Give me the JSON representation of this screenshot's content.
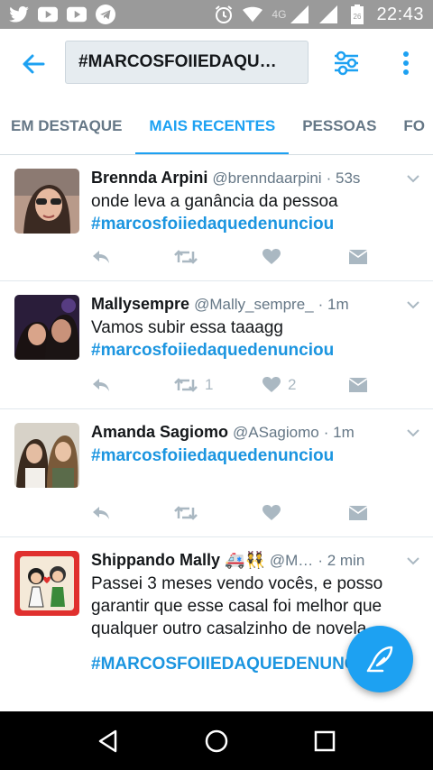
{
  "status_bar": {
    "time": "22:43",
    "network": "4G",
    "battery_level": "26",
    "icons": [
      "twitter-icon",
      "youtube-icon",
      "youtube-icon",
      "telegram-icon",
      "alarm-icon",
      "wifi-icon",
      "signal-icon",
      "battery-icon"
    ]
  },
  "header": {
    "search_query": "#MARCOSFOIIEDAQU…"
  },
  "tabs": [
    {
      "label": "EM DESTAQUE",
      "active": false
    },
    {
      "label": "MAIS RECENTES",
      "active": true
    },
    {
      "label": "PESSOAS",
      "active": false
    },
    {
      "label": "FO",
      "active": false
    }
  ],
  "tweets": [
    {
      "name": "Brennda Arpini",
      "handle": "@brenndaarpini",
      "time": "· 53s",
      "text": "onde leva a ganância da pessoa",
      "hashtag": "#marcosfoiiedaquedenunciou",
      "retweets": "",
      "likes": ""
    },
    {
      "name": "Mallysempre",
      "handle": "@Mally_sempre_",
      "time": "· 1m",
      "text": "Vamos subir essa taaagg",
      "hashtag": "#marcosfoiiedaquedenunciou",
      "retweets": "1",
      "likes": "2"
    },
    {
      "name": "Amanda Sagiomo",
      "handle": "@ASagiomo",
      "time": "· 1m",
      "text": "",
      "hashtag": "#marcosfoiiedaquedenunciou",
      "retweets": "",
      "likes": ""
    },
    {
      "name": "Shippando Mally",
      "emoji": "🚑👯",
      "handle": "@M…",
      "time": "· 2 min",
      "text": "Passei 3 meses vendo vocês, e posso garantir que esse casal foi melhor que qualquer outro casalzinho de novela",
      "hashtag": "#MARCOSFOIIEDAQUEDENUNCIOU",
      "retweets": "",
      "likes": ""
    }
  ],
  "colors": {
    "accent": "#1da1f2",
    "hashtag": "#1b95e0",
    "status_bar": "#9a9a9a",
    "muted": "#657786",
    "action_icons": "#aab8c2"
  }
}
